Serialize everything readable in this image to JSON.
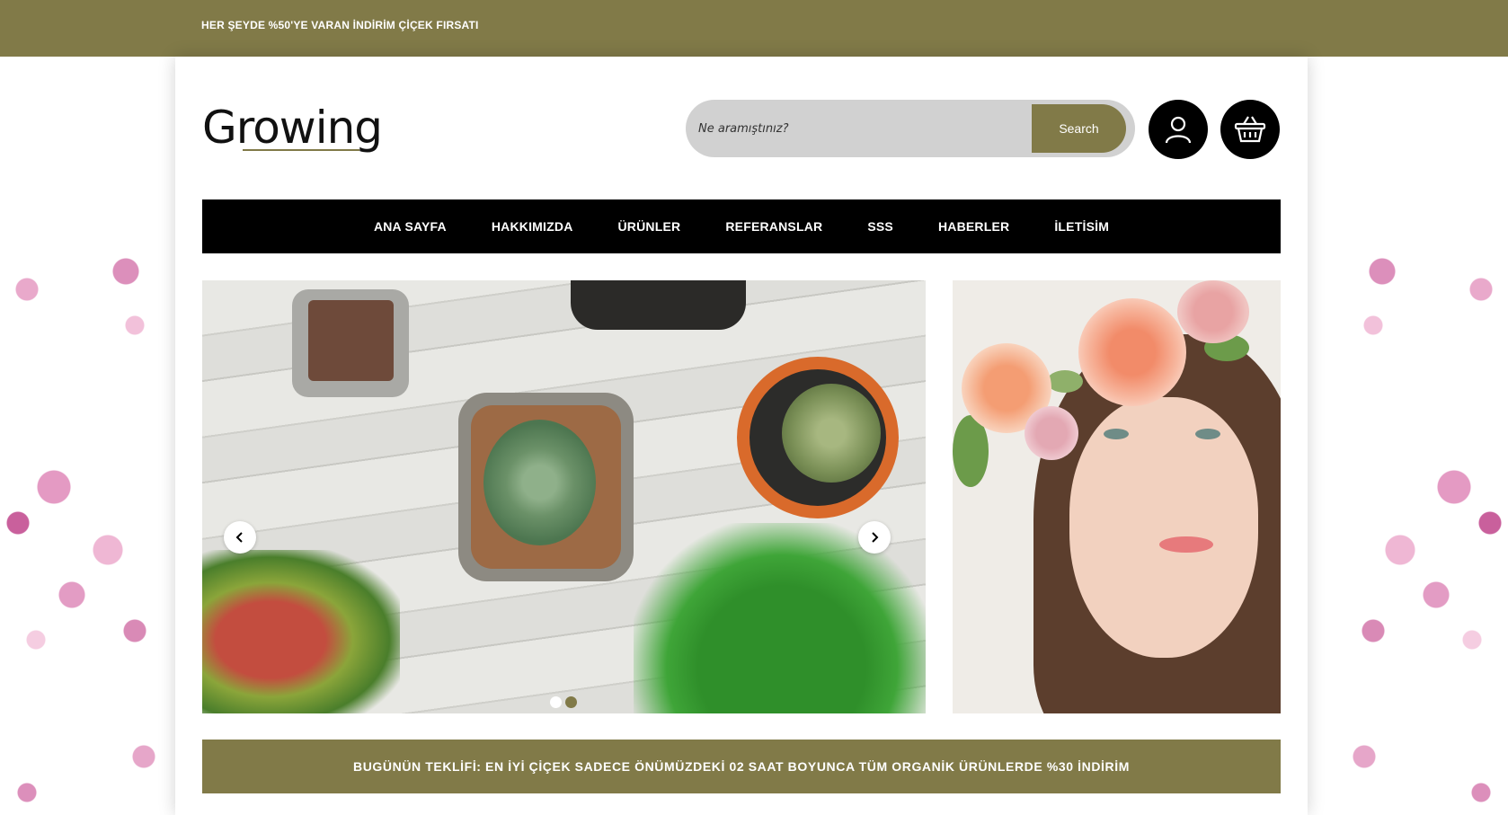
{
  "topbar": {
    "promo_text": "HER ŞEYDE %50'YE VARAN İNDİRİM ÇİÇEK FIRSATI"
  },
  "brand": {
    "logo_text": "Growing"
  },
  "search": {
    "placeholder": "Ne aramıştınız?",
    "button_label": "Search"
  },
  "nav": {
    "items": [
      {
        "label": "ANA SAYFA"
      },
      {
        "label": "HAKKIMIZDA"
      },
      {
        "label": "ÜRÜNLER"
      },
      {
        "label": "REFERANSLAR"
      },
      {
        "label": "SSS"
      },
      {
        "label": "HABERLER"
      },
      {
        "label": "İLETİSİM"
      }
    ]
  },
  "slider": {
    "slide_count": 2,
    "active_slide": 1
  },
  "offer": {
    "text": "BUGÜNÜN TEKLİFİ: EN İYİ ÇİÇEK SADECE ÖNÜMÜZDEKİ 02 SAAT BOYUNCA TÜM ORGANİK ÜRÜNLERDE %30 İNDİRİM"
  },
  "colors": {
    "accent": "#817a48",
    "nav_bg": "#000000",
    "search_bg": "#d1d1d1"
  },
  "icons": {
    "user": "user-icon",
    "cart": "basket-icon",
    "prev": "chevron-left-icon",
    "next": "chevron-right-icon"
  }
}
